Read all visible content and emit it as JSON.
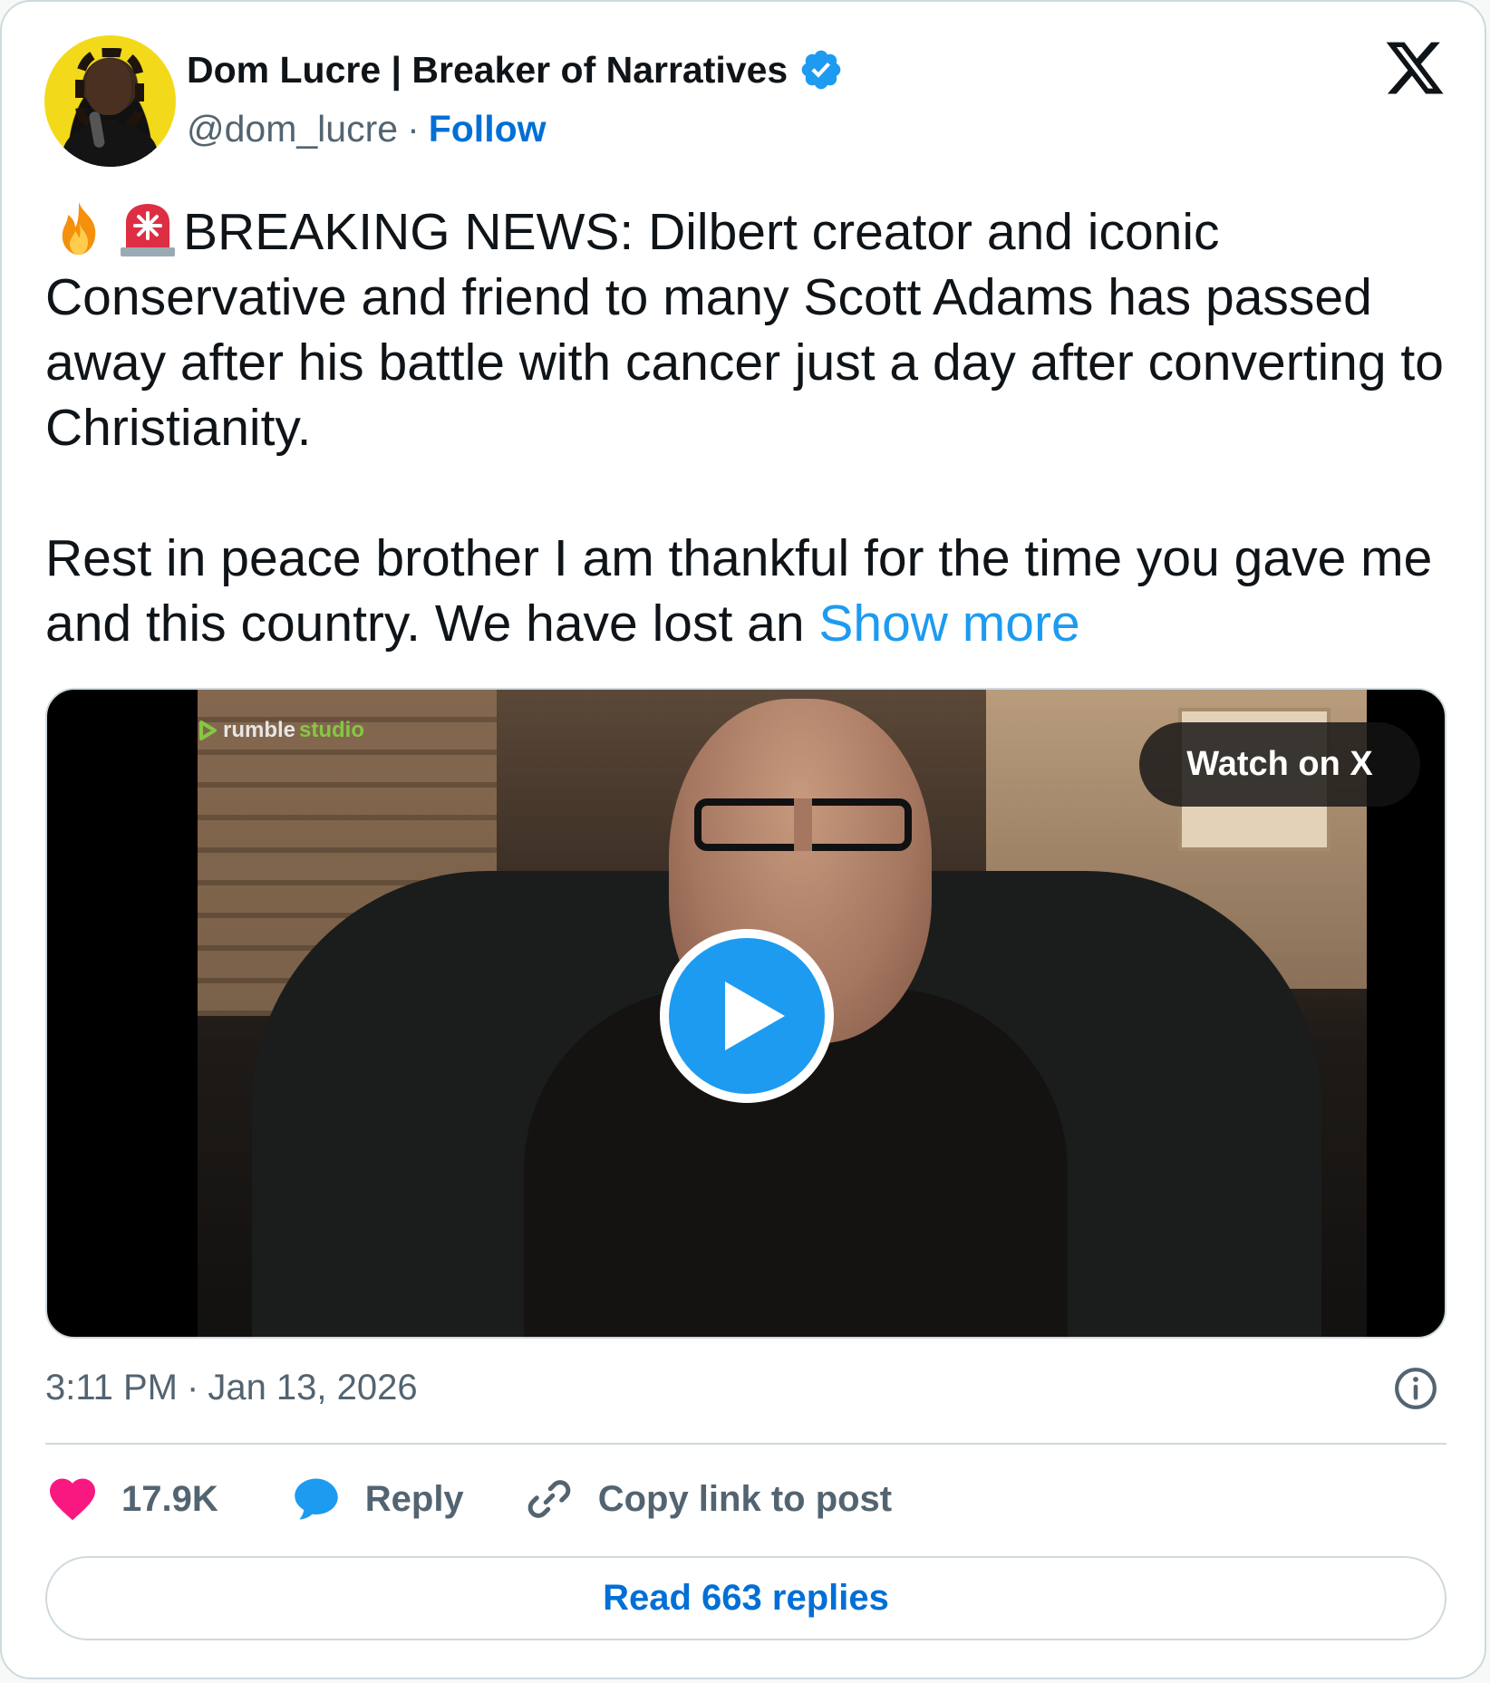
{
  "author": {
    "display_name": "Dom Lucre | Breaker of Narratives",
    "handle": "@dom_lucre",
    "separator": "·",
    "follow_label": "Follow",
    "verified": true
  },
  "tweet": {
    "emojis": [
      "fire-emoji",
      "police-light-emoji"
    ],
    "paragraph_1": "BREAKING NEWS: Dilbert creator and iconic Conservative and friend to many Scott Adams has passed away after his battle with cancer just a day after converting to Christianity.",
    "paragraph_2": "Rest in peace brother I am thankful for the time you gave me and this country. We have lost an ",
    "show_more_label": "Show more"
  },
  "media": {
    "watermark_brand": "rumble",
    "watermark_product": "studio",
    "watch_label": "Watch on X"
  },
  "meta": {
    "time": "3:11 PM",
    "separator": "·",
    "date": "Jan 13, 2026"
  },
  "actions": {
    "likes_count": "17.9K",
    "reply_label": "Reply",
    "copy_link_label": "Copy link to post"
  },
  "read_replies_label": "Read 663 replies",
  "colors": {
    "link_blue": "#006fd6",
    "show_more_blue": "#1d9bf0",
    "like_pink": "#f91880",
    "reply_blue": "#1d9bf0",
    "secondary_text": "#536471",
    "border": "#cfd9de"
  }
}
